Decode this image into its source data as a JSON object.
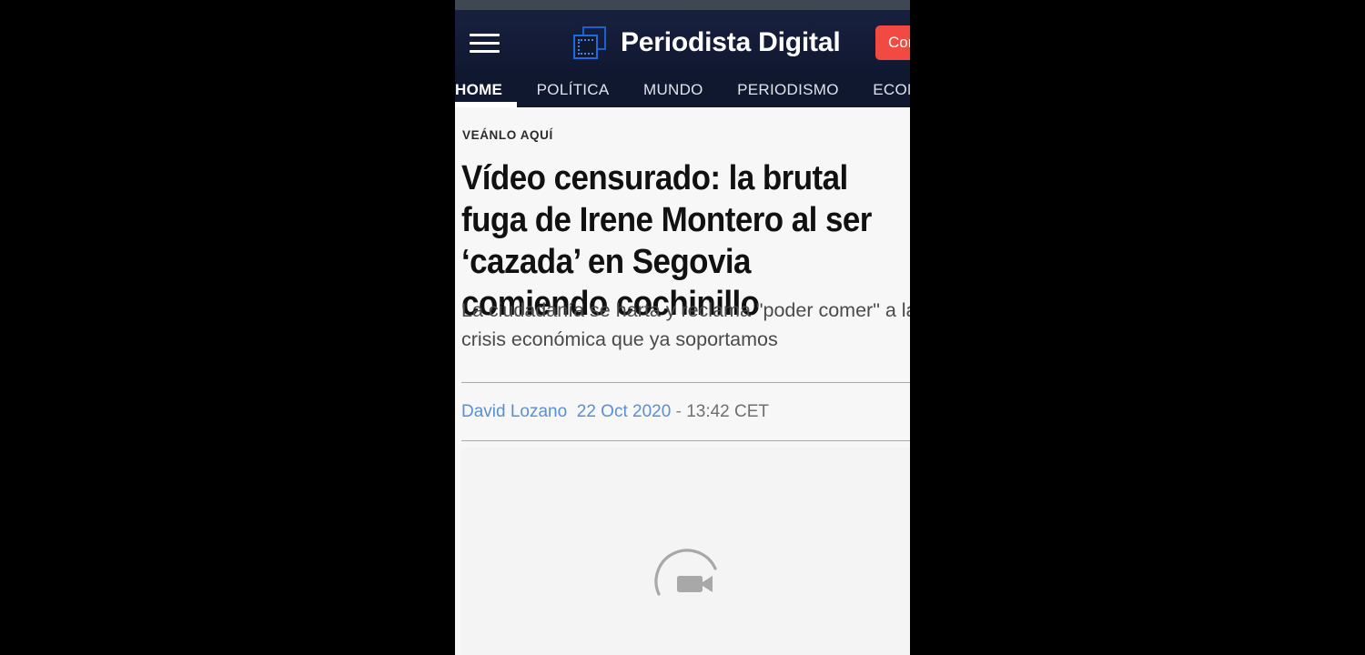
{
  "site": {
    "brand_title": "Periodista Digital",
    "logo_icon": "overlapping-squares-logo-icon",
    "menu_icon": "hamburger-menu-icon",
    "cta_label": "Cont",
    "accent_red": "#f04a42",
    "header_navy": "#101830",
    "link_blue": "#5b8fd0"
  },
  "nav": {
    "items": [
      {
        "label": "HOME",
        "active": true
      },
      {
        "label": "POLÍTICA",
        "active": false
      },
      {
        "label": "MUNDO",
        "active": false
      },
      {
        "label": "PERIODISMO",
        "active": false
      },
      {
        "label": "ECONO",
        "active": false
      }
    ]
  },
  "article": {
    "kicker": "VEÁNLO AQUÍ",
    "headline": "Vídeo censurado: la brutal fuga de Irene Montero al ser ‘cazada’ en Segovia comiendo cochinillo",
    "standfirst": "La ciudadanía se harta y reclama \"poder comer\" a la crisis económica que ya soportamos",
    "byline": {
      "author": "David Lozano",
      "date": "22 Oct 2020",
      "separator": "-",
      "time": "13:42 CET"
    },
    "media": {
      "type": "video",
      "state": "loading",
      "icon": "video-camera-icon",
      "spinner_icon": "loading-arc-spinner-icon"
    }
  }
}
